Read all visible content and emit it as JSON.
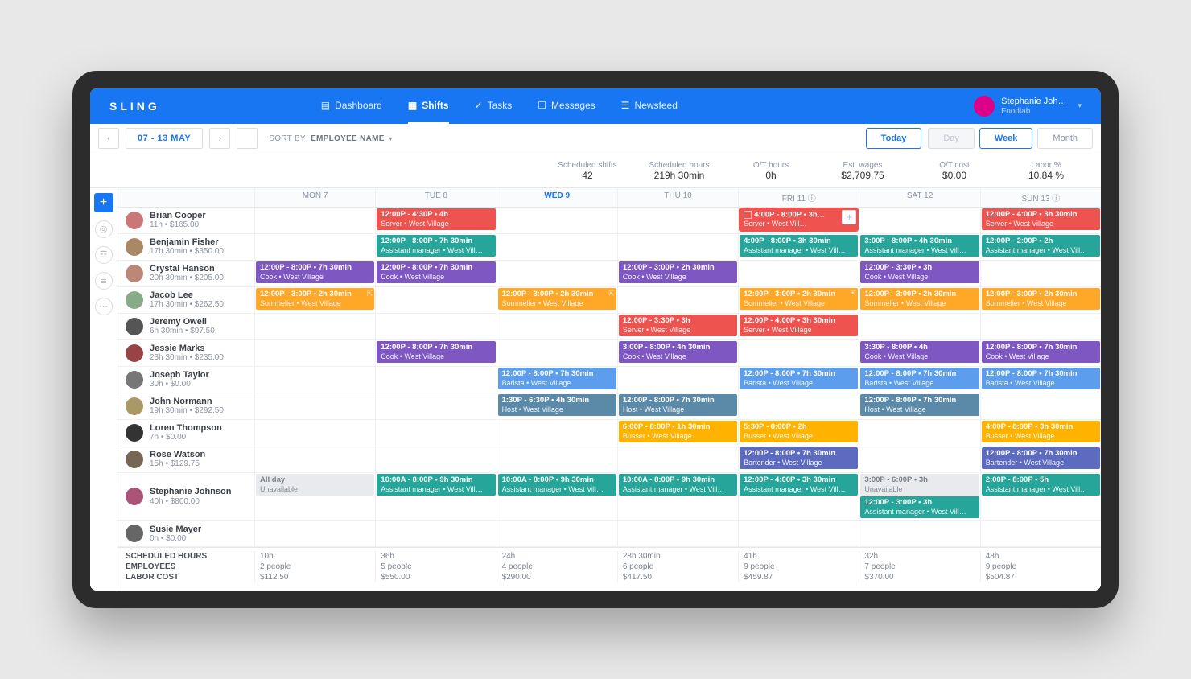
{
  "brand": "SLING",
  "nav": {
    "dashboard": "Dashboard",
    "shifts": "Shifts",
    "tasks": "Tasks",
    "messages": "Messages",
    "newsfeed": "Newsfeed"
  },
  "user": {
    "name": "Stephanie Joh…",
    "org": "Foodlab"
  },
  "toolbar": {
    "date_range": "07 - 13 MAY",
    "sortby_label": "SORT BY",
    "sortby_value": "EMPLOYEE NAME",
    "today": "Today",
    "day": "Day",
    "week": "Week",
    "month": "Month"
  },
  "stats": [
    {
      "label": "Scheduled shifts",
      "value": "42"
    },
    {
      "label": "Scheduled hours",
      "value": "219h 30min"
    },
    {
      "label": "O/T hours",
      "value": "0h"
    },
    {
      "label": "Est. wages",
      "value": "$2,709.75"
    },
    {
      "label": "O/T cost",
      "value": "$0.00"
    },
    {
      "label": "Labor %",
      "value": "10.84 %"
    }
  ],
  "days": [
    "MON 7",
    "TUE 8",
    "WED 9",
    "THU 10",
    "FRI 11",
    "SAT 12",
    "SUN 13"
  ],
  "current_day_index": 2,
  "info_day_indexes": [
    4,
    6
  ],
  "employees": [
    {
      "name": "Brian Cooper",
      "sub": "11h • $165.00",
      "av": "#c77",
      "shifts": [
        null,
        {
          "l1": "12:00P - 4:30P • 4h",
          "l2": "Server • West Village",
          "color": "c-red"
        },
        null,
        null,
        {
          "l1": "4:00P - 8:00P • 3h…",
          "l2": "Server • West Vill…",
          "color": "c-red",
          "highlight": true,
          "checkbox": true,
          "addbtn": true
        },
        null,
        {
          "l1": "12:00P - 4:00P • 3h 30min",
          "l2": "Server • West Village",
          "color": "c-red"
        }
      ]
    },
    {
      "name": "Benjamin Fisher",
      "sub": "17h 30min • $350.00",
      "av": "#a86",
      "shifts": [
        null,
        {
          "l1": "12:00P - 8:00P • 7h 30min",
          "l2": "Assistant manager • West Vill…",
          "color": "c-teal"
        },
        null,
        null,
        {
          "l1": "4:00P - 8:00P • 3h 30min",
          "l2": "Assistant manager • West Vill…",
          "color": "c-teal"
        },
        {
          "l1": "3:00P - 8:00P • 4h 30min",
          "l2": "Assistant manager • West Vill…",
          "color": "c-teal"
        },
        {
          "l1": "12:00P - 2:00P • 2h",
          "l2": "Assistant manager • West Vill…",
          "color": "c-teal"
        }
      ]
    },
    {
      "name": "Crystal Hanson",
      "sub": "20h 30min • $205.00",
      "av": "#b87",
      "shifts": [
        {
          "l1": "12:00P - 8:00P • 7h 30min",
          "l2": "Cook • West Village",
          "color": "c-purple"
        },
        {
          "l1": "12:00P - 8:00P • 7h 30min",
          "l2": "Cook • West Village",
          "color": "c-purple"
        },
        null,
        {
          "l1": "12:00P - 3:00P • 2h 30min",
          "l2": "Cook • West Village",
          "color": "c-purple"
        },
        null,
        {
          "l1": "12:00P - 3:30P • 3h",
          "l2": "Cook • West Village",
          "color": "c-purple"
        },
        null
      ]
    },
    {
      "name": "Jacob Lee",
      "sub": "17h 30min • $262.50",
      "av": "#8a8",
      "shifts": [
        {
          "l1": "12:00P - 3:00P • 2h 30min",
          "l2": "Sommelier • West Village",
          "color": "c-orange",
          "pop": true
        },
        null,
        {
          "l1": "12:00P - 3:00P • 2h 30min",
          "l2": "Sommelier • West Village",
          "color": "c-orange",
          "pop": true
        },
        null,
        {
          "l1": "12:00P - 3:00P • 2h 30min",
          "l2": "Sommelier • West Village",
          "color": "c-orange",
          "pop": true
        },
        {
          "l1": "12:00P - 3:00P • 2h 30min",
          "l2": "Sommelier • West Village",
          "color": "c-orange"
        },
        {
          "l1": "12:00P - 3:00P • 2h 30min",
          "l2": "Sommelier • West Village",
          "color": "c-orange"
        }
      ]
    },
    {
      "name": "Jeremy Owell",
      "sub": "6h 30min • $97.50",
      "av": "#555",
      "shifts": [
        null,
        null,
        null,
        {
          "l1": "12:00P - 3:30P • 3h",
          "l2": "Server • West Village",
          "color": "c-red"
        },
        {
          "l1": "12:00P - 4:00P • 3h 30min",
          "l2": "Server • West Village",
          "color": "c-red"
        },
        null,
        null
      ]
    },
    {
      "name": "Jessie Marks",
      "sub": "23h 30min • $235.00",
      "av": "#944",
      "shifts": [
        null,
        {
          "l1": "12:00P - 8:00P • 7h 30min",
          "l2": "Cook • West Village",
          "color": "c-purple"
        },
        null,
        {
          "l1": "3:00P - 8:00P • 4h 30min",
          "l2": "Cook • West Village",
          "color": "c-purple"
        },
        null,
        {
          "l1": "3:30P - 8:00P • 4h",
          "l2": "Cook • West Village",
          "color": "c-purple"
        },
        {
          "l1": "12:00P - 8:00P • 7h 30min",
          "l2": "Cook • West Village",
          "color": "c-purple"
        }
      ]
    },
    {
      "name": "Joseph Taylor",
      "sub": "30h • $0.00",
      "av": "#777",
      "shifts": [
        null,
        null,
        {
          "l1": "12:00P - 8:00P • 7h 30min",
          "l2": "Barista • West Village",
          "color": "c-blue"
        },
        null,
        {
          "l1": "12:00P - 8:00P • 7h 30min",
          "l2": "Barista • West Village",
          "color": "c-blue"
        },
        {
          "l1": "12:00P - 8:00P • 7h 30min",
          "l2": "Barista • West Village",
          "color": "c-blue"
        },
        {
          "l1": "12:00P - 8:00P • 7h 30min",
          "l2": "Barista • West Village",
          "color": "c-blue"
        }
      ]
    },
    {
      "name": "John Normann",
      "sub": "19h 30min • $292.50",
      "av": "#a96",
      "shifts": [
        null,
        null,
        {
          "l1": "1:30P - 6:30P • 4h 30min",
          "l2": "Host • West Village",
          "color": "c-slate"
        },
        {
          "l1": "12:00P - 8:00P • 7h 30min",
          "l2": "Host • West Village",
          "color": "c-slate"
        },
        null,
        {
          "l1": "12:00P - 8:00P • 7h 30min",
          "l2": "Host • West Village",
          "color": "c-slate"
        },
        null
      ]
    },
    {
      "name": "Loren Thompson",
      "sub": "7h • $0.00",
      "av": "#333",
      "shifts": [
        null,
        null,
        null,
        {
          "l1": "6:00P - 8:00P • 1h 30min",
          "l2": "Busser • West Village",
          "color": "c-amber"
        },
        {
          "l1": "5:30P - 8:00P • 2h",
          "l2": "Busser • West Village",
          "color": "c-amber"
        },
        null,
        {
          "l1": "4:00P - 8:00P • 3h 30min",
          "l2": "Busser • West Village",
          "color": "c-amber"
        }
      ]
    },
    {
      "name": "Rose Watson",
      "sub": "15h • $129.75",
      "av": "#765",
      "shifts": [
        null,
        null,
        null,
        null,
        {
          "l1": "12:00P - 8:00P • 7h 30min",
          "l2": "Bartender • West Village",
          "color": "c-indigo"
        },
        null,
        {
          "l1": "12:00P - 8:00P • 7h 30min",
          "l2": "Bartender • West Village",
          "color": "c-indigo"
        }
      ]
    },
    {
      "name": "Stephanie Johnson",
      "sub": "40h • $800.00",
      "av": "#a57",
      "shifts": [
        {
          "l1": "All day",
          "l2": "Unavailable",
          "color": "unavail"
        },
        {
          "l1": "10:00A - 8:00P • 9h 30min",
          "l2": "Assistant manager • West Vill…",
          "color": "c-teal"
        },
        {
          "l1": "10:00A - 8:00P • 9h 30min",
          "l2": "Assistant manager • West Vill…",
          "color": "c-teal"
        },
        {
          "l1": "10:00A - 8:00P • 9h 30min",
          "l2": "Assistant manager • West Vill…",
          "color": "c-teal"
        },
        {
          "l1": "12:00P - 4:00P • 3h 30min",
          "l2": "Assistant manager • West Vill…",
          "color": "c-teal"
        },
        [
          {
            "l1": "3:00P - 6:00P • 3h",
            "l2": "Unavailable",
            "color": "unavail"
          },
          {
            "l1": "12:00P - 3:00P • 3h",
            "l2": "Assistant manager • West Vill…",
            "color": "c-teal"
          }
        ],
        {
          "l1": "2:00P - 8:00P • 5h",
          "l2": "Assistant manager • West Vill…",
          "color": "c-teal"
        }
      ]
    },
    {
      "name": "Susie Mayer",
      "sub": "0h • $0.00",
      "av": "#666",
      "shifts": [
        null,
        null,
        null,
        null,
        null,
        null,
        null
      ]
    }
  ],
  "footer": {
    "rows": [
      "SCHEDULED HOURS",
      "EMPLOYEES",
      "LABOR COST"
    ],
    "cols": [
      [
        "10h",
        "2 people",
        "$112.50"
      ],
      [
        "36h",
        "5 people",
        "$550.00"
      ],
      [
        "24h",
        "4 people",
        "$290.00"
      ],
      [
        "28h 30min",
        "6 people",
        "$417.50"
      ],
      [
        "41h",
        "9 people",
        "$459.87"
      ],
      [
        "32h",
        "7 people",
        "$370.00"
      ],
      [
        "48h",
        "9 people",
        "$504.87"
      ]
    ]
  }
}
